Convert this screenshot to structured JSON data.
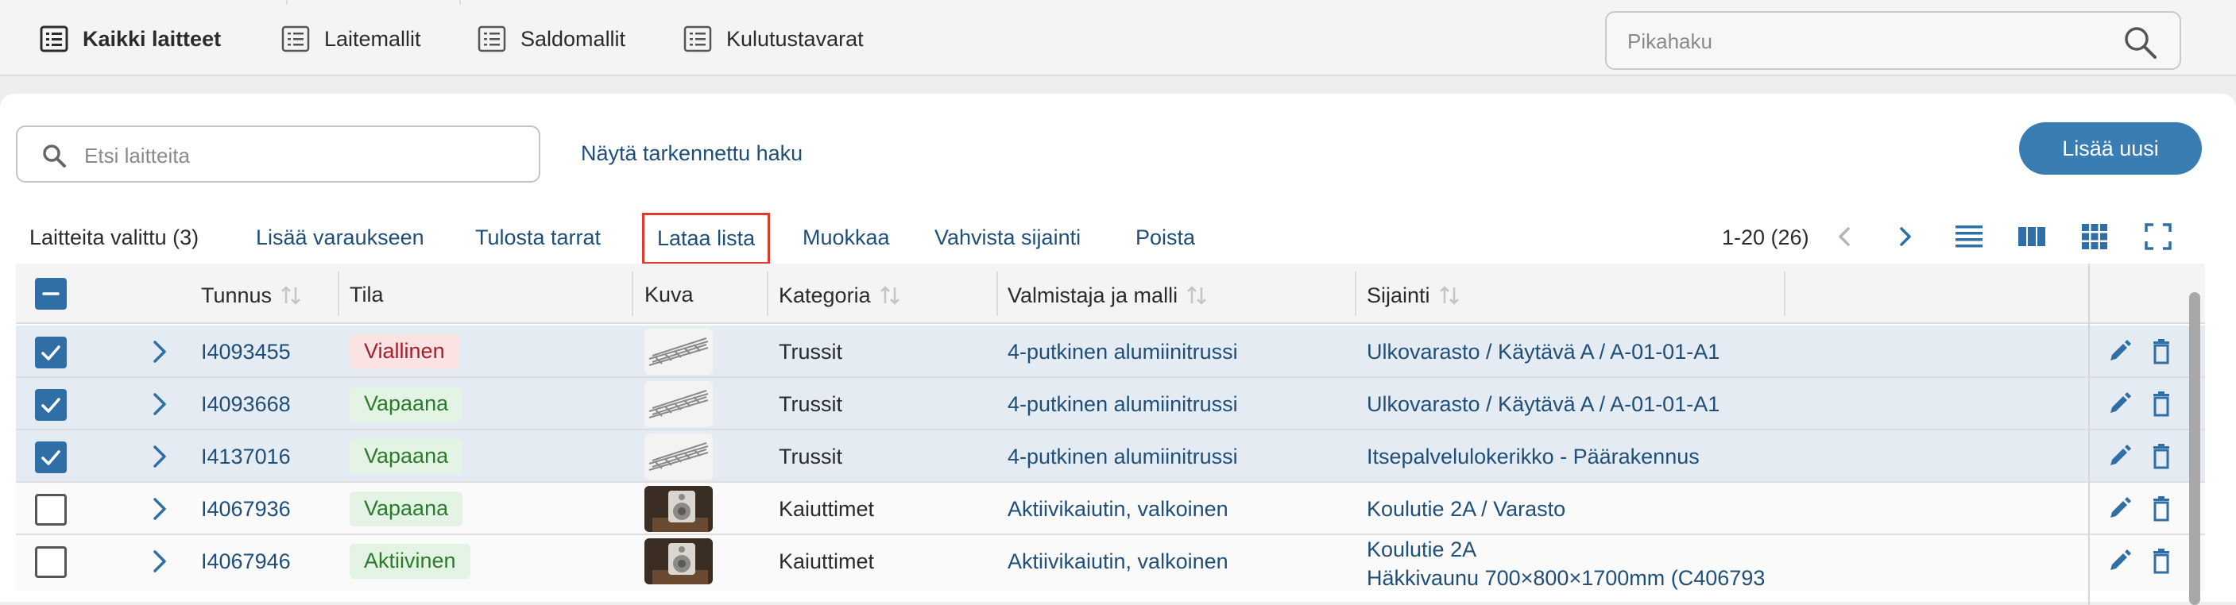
{
  "topnav": {
    "tabs": [
      {
        "label": "Kaikki laitteet",
        "active": true
      },
      {
        "label": "Laitemallit",
        "active": false
      },
      {
        "label": "Saldomallit",
        "active": false
      },
      {
        "label": "Kulutustavarat",
        "active": false
      }
    ],
    "quicksearch_placeholder": "Pikahaku"
  },
  "toolbar": {
    "search_placeholder": "Etsi laitteita",
    "advanced_search": "Näytä tarkennettu haku",
    "add_new": "Lisää uusi"
  },
  "actions": {
    "selected_count": "Laitteita valittu (3)",
    "add_to_reservation": "Lisää varaukseen",
    "print_labels": "Tulosta tarrat",
    "download_list": "Lataa lista",
    "edit": "Muokkaa",
    "confirm_location": "Vahvista sijainti",
    "delete": "Poista",
    "pagination": "1-20 (26)"
  },
  "table": {
    "columns": {
      "id": "Tunnus",
      "status": "Tila",
      "image": "Kuva",
      "category": "Kategoria",
      "model": "Valmistaja ja malli",
      "location": "Sijainti"
    },
    "rows": [
      {
        "checked": true,
        "id": "I4093455",
        "status": "Viallinen",
        "status_color": "red",
        "image": "truss",
        "category": "Trussit",
        "model": "4-putkinen alumiinitrussi",
        "location": "Ulkovarasto / Käytävä A / A-01-01-A1"
      },
      {
        "checked": true,
        "id": "I4093668",
        "status": "Vapaana",
        "status_color": "green",
        "image": "truss",
        "category": "Trussit",
        "model": "4-putkinen alumiinitrussi",
        "location": "Ulkovarasto / Käytävä A / A-01-01-A1"
      },
      {
        "checked": true,
        "id": "I4137016",
        "status": "Vapaana",
        "status_color": "green",
        "image": "truss",
        "category": "Trussit",
        "model": "4-putkinen alumiinitrussi",
        "location": "Itsepalvelulokerikko - Päärakennus"
      },
      {
        "checked": false,
        "id": "I4067936",
        "status": "Vapaana",
        "status_color": "green",
        "image": "speaker",
        "category": "Kaiuttimet",
        "model": "Aktiivikaiutin, valkoinen",
        "location": "Koulutie 2A / Varasto"
      },
      {
        "checked": false,
        "id": "I4067946",
        "status": "Aktiivinen",
        "status_color": "green",
        "image": "speaker",
        "category": "Kaiuttimet",
        "model": "Aktiivikaiutin, valkoinen",
        "location": "Koulutie 2A",
        "location_line2": "Häkkivaunu 700×800×1700mm (C406793"
      }
    ]
  },
  "colors": {
    "accent": "#3a7db3",
    "link": "#1f4e79",
    "highlight_border": "#e03a2a",
    "selected_row": "#e4ebf2"
  }
}
